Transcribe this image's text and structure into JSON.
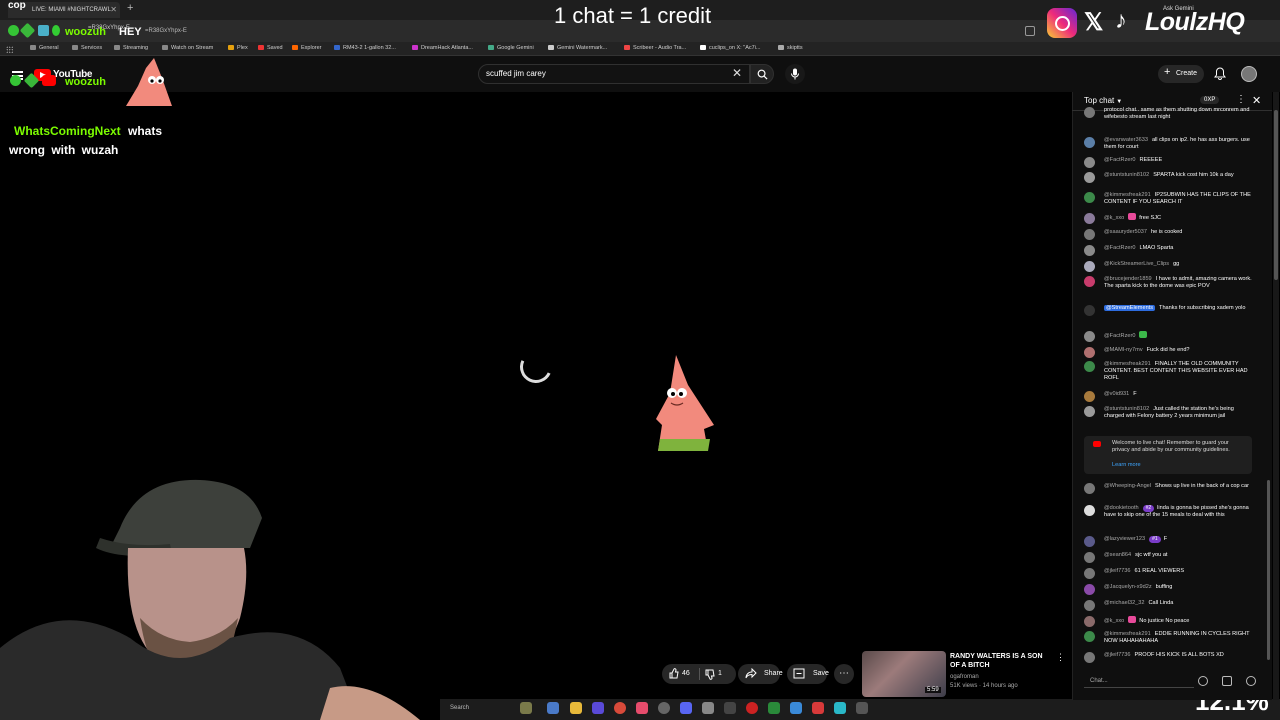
{
  "browser": {
    "tab_title": "LIVE: MIAMI #NIGHTCRAWL",
    "url_fragment": "=R38GxYhpx-E",
    "bookmarks": [
      "General",
      "Services",
      "Streaming",
      "Watch on Stream",
      "Plex",
      "Saved",
      "Explorer",
      "RM43-2 1-gallon 32...",
      "DreamHack Atlanta...",
      "Google Gemini",
      "Gemini Watermark...",
      "Scribeer - Audio Tra...",
      "cuclips_on X: \"Ac7i...",
      "skiptts"
    ]
  },
  "youtube": {
    "logo_text": "YouTube",
    "search_value": "scuffed jim carey",
    "create_label": "Create"
  },
  "overlay": {
    "cop_text": "cop",
    "woozuh_name": "woozuh",
    "woozuh_msg": "HEY",
    "woozuh_name_2": "woozuh",
    "chat_name": "WhatsComingNext",
    "chat_msg_1": "whats",
    "chat_msg_2": "wrong with wuzah",
    "credit_banner": "1 chat = 1 credit",
    "social_handle": "LoulzHQ",
    "ask_gemini": "Ask Gemini",
    "percent": "12.1%"
  },
  "actions": {
    "likes": "46",
    "dislikes": "1",
    "share_label": "Share",
    "save_label": "Save"
  },
  "recommendation": {
    "title": "RANDY WALTERS IS A SON OF A BITCH",
    "channel": "ogafroman",
    "meta": "51K views · 14 hours ago",
    "duration": "5:59"
  },
  "taskbar": {
    "search_label": "Search"
  },
  "chat": {
    "header": "Top chat",
    "xp": "0XP",
    "notice": "Welcome to live chat! Remember to guard your privacy and abide by our community guidelines.",
    "notice_link": "Learn more",
    "input_placeholder": "Chat...",
    "messages": [
      {
        "user": "",
        "text": "protocol chat.. same as them shutting down mrconrem and wifebesto stream last night"
      },
      {
        "user": "@evanwater3633",
        "text": "all clips on ip2. he has ass burgers. use them for court"
      },
      {
        "user": "@FactRzer0",
        "text": "REEEEE"
      },
      {
        "user": "@stuntstunin8102",
        "text": "SPARTA kick cost him 10k a day"
      },
      {
        "user": "@kimmesfreak291",
        "text": "IP2SUBWIN HAS THE CLIPS OF THE CONTENT IF YOU SEARCH IT"
      },
      {
        "user": "@k_xxo",
        "text": "free SJC"
      },
      {
        "user": "@saauryder5037",
        "text": "he is cooked"
      },
      {
        "user": "@FactRzer0",
        "text": "LMAO Sparta"
      },
      {
        "user": "@KickStreamerLive_Clips",
        "text": "gg"
      },
      {
        "user": "@brucejender1859",
        "text": "I have to admit, amazing camera work. The sparta kick to the dome was epic POV"
      },
      {
        "user": "@StreamElements",
        "text": "Thanks for subscribing xadem yolo"
      },
      {
        "user": "@FactRzer0",
        "text": ""
      },
      {
        "user": "@MAMI-ny7mv",
        "text": "Fuck did he end?"
      },
      {
        "user": "@kimmesfreak291",
        "text": "FINALLY THE OLD COMMUNITY CONTENT. BEST CONTENT THIS WEBSITE EVER HAD ROFL"
      },
      {
        "user": "@v0id931",
        "text": "F"
      },
      {
        "user": "@stuntstunin8102",
        "text": "Just called the station he's being charged with Felony battery 2 years minimum jail"
      },
      {
        "user": "@Wheeping-Angel",
        "text": "Shows up live in the back of a cop car"
      },
      {
        "user": "@dookietooth",
        "badge": "#2",
        "text": "linda is gonna be pissed she's gonna have to skip one of the 15 meals to deal with this"
      },
      {
        "user": "@lazyviewer123",
        "badge": "#1",
        "text": "F"
      },
      {
        "user": "@sean864",
        "text": "sjc wtf you at"
      },
      {
        "user": "@jleif7736",
        "text": "61 REAL VIEWERS"
      },
      {
        "user": "@Jacquelyn-x9d2z",
        "text": "buffing"
      },
      {
        "user": "@michael32_32",
        "text": "Call Linda"
      },
      {
        "user": "@k_xxo",
        "text": "No justice No peace"
      },
      {
        "user": "@kimmesfreak291",
        "text": "EDDIE RUNNING IN CYCLES RIGHT NOW HAHAHAHAHA"
      },
      {
        "user": "@jleif7736",
        "text": "PROOF HIS KICK IS ALL BOTS XD"
      }
    ]
  }
}
